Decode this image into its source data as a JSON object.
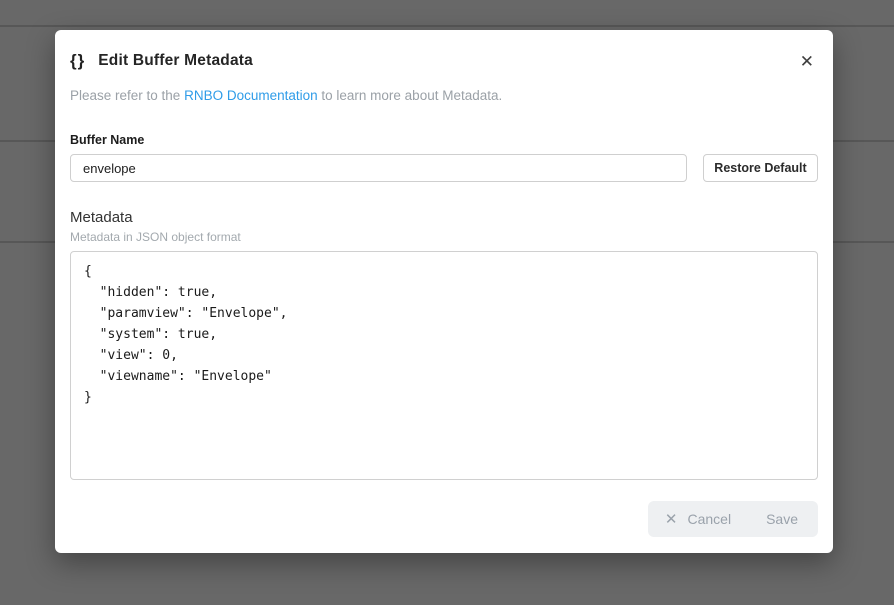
{
  "modal": {
    "icon": "{}",
    "title": "Edit Buffer Metadata",
    "close_icon": "✕",
    "description": {
      "prefix": "Please refer to the ",
      "link": "RNBO Documentation",
      "suffix": " to learn more about Metadata."
    },
    "buffer_name": {
      "label": "Buffer Name",
      "value": "envelope",
      "restore_button": "Restore Default"
    },
    "metadata": {
      "label": "Metadata",
      "hint": "Metadata in JSON object format",
      "value": "{\n  \"hidden\": true,\n  \"paramview\": \"Envelope\",\n  \"system\": true,\n  \"view\": 0,\n  \"viewname\": \"Envelope\"\n}"
    },
    "footer": {
      "cancel_icon": "✕",
      "cancel_label": "Cancel",
      "save_label": "Save"
    }
  },
  "colors": {
    "link_blue": "#2f9ce8",
    "overlay_gray": "#686868",
    "footer_group_bg": "#eef0f2"
  }
}
